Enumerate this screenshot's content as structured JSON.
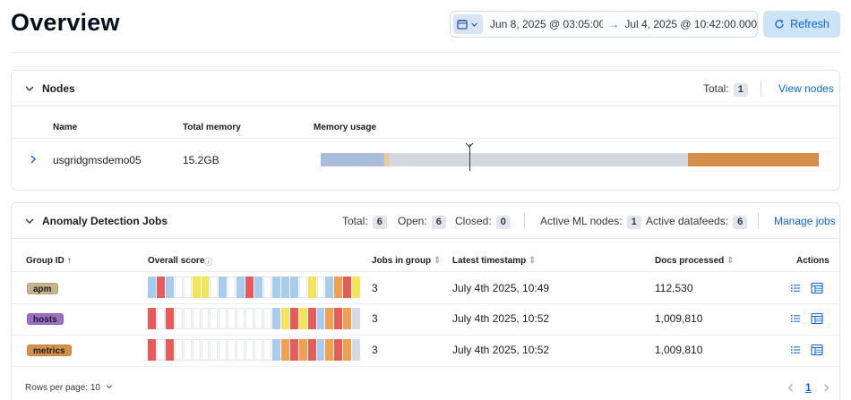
{
  "header": {
    "title": "Overview",
    "date_start": "Jun 8, 2025 @ 03:05:00.0...",
    "date_arrow": "→",
    "date_end": "Jul 4, 2025 @ 10:42:00.000",
    "refresh_label": "Refresh",
    "calendar_icon": "calendar-icon",
    "refresh_icon": "refresh-icon"
  },
  "nodes": {
    "title": "Nodes",
    "total_label": "Total:",
    "total_value": "1",
    "view_link": "View nodes",
    "columns": [
      "Name",
      "Total memory",
      "Memory usage"
    ],
    "rows": [
      {
        "name": "usgridgmsdemo05",
        "total_memory": "15.2GB"
      }
    ],
    "memory_bar_colors": [
      "#a8bddb",
      "#f1c98e",
      "#d3d8df",
      "#d68d4a"
    ]
  },
  "jobs": {
    "title": "Anomaly Detection Jobs",
    "total_label": "Total:",
    "total_value": "6",
    "open_label": "Open:",
    "open_value": "6",
    "closed_label": "Closed:",
    "closed_value": "0",
    "ml_nodes_label": "Active ML nodes:",
    "ml_nodes_value": "1",
    "datafeeds_label": "Active datafeeds:",
    "datafeeds_value": "6",
    "manage_link": "Manage jobs",
    "columns": {
      "group_id": "Group ID",
      "overall_score": "Overall score",
      "jobs_in_group": "Jobs in group",
      "latest_timestamp": "Latest timestamp",
      "docs_processed": "Docs processed",
      "actions": "Actions"
    },
    "rows": [
      {
        "group": "apm",
        "group_color": "#c4b48b",
        "jobs": "3",
        "timestamp": "July 4th 2025, 10:49",
        "docs": "112,530"
      },
      {
        "group": "hosts",
        "group_color": "#9b6ec6",
        "jobs": "3",
        "timestamp": "July 4th 2025, 10:52",
        "docs": "1,009,810"
      },
      {
        "group": "metrics",
        "group_color": "#d69048",
        "jobs": "3",
        "timestamp": "July 4th 2025, 10:52",
        "docs": "1,009,810"
      }
    ],
    "swimlanes": [
      [
        "#a8ccf0",
        "#e75b5b",
        "#a8ccf0",
        "#ffffff",
        "#ffffff",
        "#f3e45a",
        "#f3e45a",
        "#ffffff",
        "#a8ccf0",
        "#ffffff",
        "#a8ccf0",
        "#e75b5b",
        "#a8ccf0",
        "#ffffff",
        "#a8ccf0",
        "#a8ccf0",
        "#a8ccf0",
        "#ffffff",
        "#f3e45a",
        "#ffffff",
        "#a8ccf0",
        "#f0a050",
        "#e75b5b",
        "#f3e45a"
      ],
      [
        "#e75b5b",
        "#ffffff",
        "#e75b5b",
        "#ffffff",
        "#ffffff",
        "#ffffff",
        "#ffffff",
        "#ffffff",
        "#ffffff",
        "#ffffff",
        "#ffffff",
        "#ffffff",
        "#ffffff",
        "#ffffff",
        "#a8ccf0",
        "#f3e45a",
        "#e75b5b",
        "#f3e45a",
        "#e75b5b",
        "#a8ccf0",
        "#f0a050",
        "#e75b5b",
        "#f0a050",
        "#d3dae6"
      ],
      [
        "#e75b5b",
        "#ffffff",
        "#e75b5b",
        "#ffffff",
        "#ffffff",
        "#ffffff",
        "#ffffff",
        "#ffffff",
        "#ffffff",
        "#ffffff",
        "#ffffff",
        "#ffffff",
        "#ffffff",
        "#ffffff",
        "#a8ccf0",
        "#f0a050",
        "#e75b5b",
        "#f0a050",
        "#e75b5b",
        "#a8ccf0",
        "#f0a050",
        "#e75b5b",
        "#f0a050",
        "#d3dae6"
      ]
    ]
  },
  "footer": {
    "rows_per_page": "Rows per page: 10",
    "current_page": "1",
    "prev_icon": "chevron-left-icon",
    "next_icon": "chevron-right-icon"
  }
}
